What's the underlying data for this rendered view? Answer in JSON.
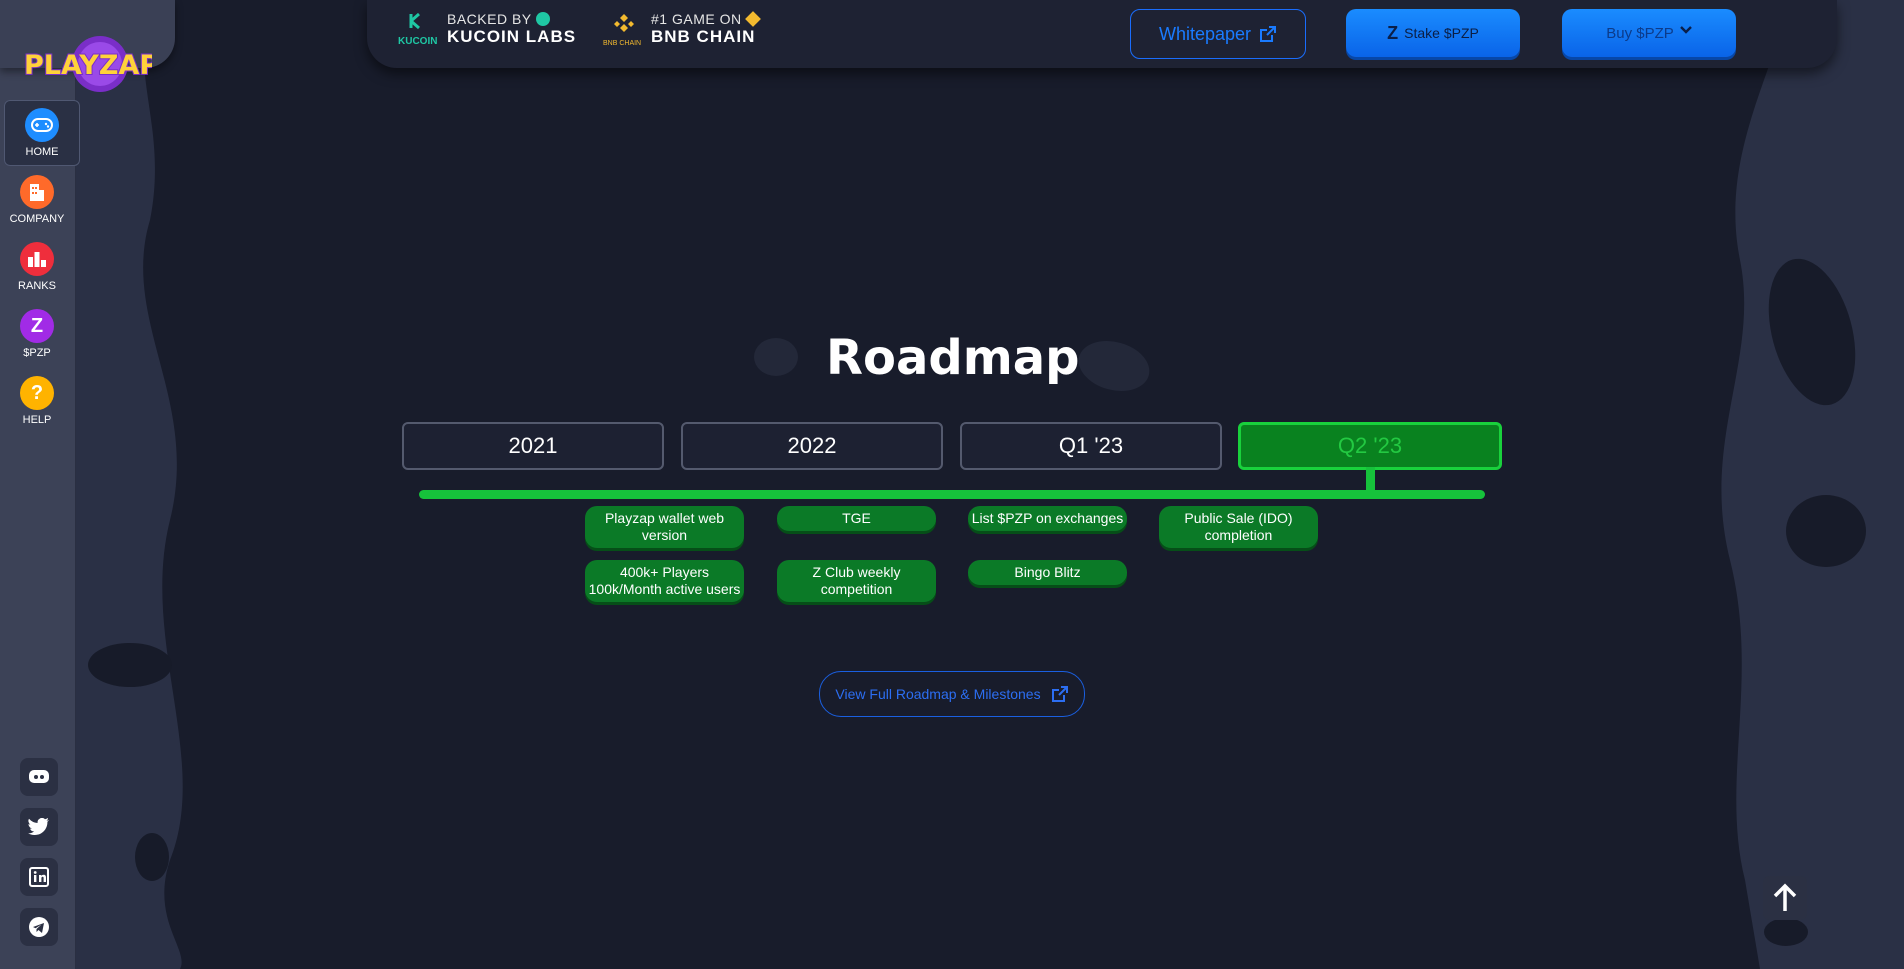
{
  "brand": {
    "logo_text": "PLAYZAP"
  },
  "sidebar": {
    "items": [
      {
        "label": "HOME",
        "icon": "gamepad-icon",
        "color": "#1e8dff"
      },
      {
        "label": "COMPANY",
        "icon": "building-icon",
        "color": "#ff6a2a"
      },
      {
        "label": "RANKS",
        "icon": "bar-chart-icon",
        "color": "#ef2e3c"
      },
      {
        "label": "$PZP",
        "icon": "pzp-coin-icon",
        "color": "#a12be6"
      },
      {
        "label": "HELP",
        "icon": "question-icon",
        "color": "#ffb300"
      }
    ],
    "socials": [
      "discord-icon",
      "twitter-icon",
      "linkedin-icon",
      "telegram-icon"
    ]
  },
  "header": {
    "backer1": {
      "small": "BACKED BY",
      "big": "KUCOIN LABS",
      "logo_text": "KUCOIN"
    },
    "backer2": {
      "small": "#1 GAME ON",
      "big": "BNB CHAIN",
      "logo_text": "BNB CHAIN"
    },
    "whitepaper_label": "Whitepaper",
    "stake_label": "Stake $PZP",
    "buy_label": "Buy $PZP"
  },
  "roadmap": {
    "title": "Roadmap",
    "tabs": [
      "2021",
      "2022",
      "Q1 '23",
      "Q2 '23"
    ],
    "active_tab": "Q2 '23",
    "milestones": {
      "col1": [
        "Playzap wallet web version",
        "400k+ Players 100k/Month active users"
      ],
      "col2": [
        "TGE",
        "Z Club weekly competition"
      ],
      "col3": [
        "List $PZP on exchanges",
        "Bingo Blitz"
      ],
      "col4": [
        "Public Sale (IDO) completion"
      ]
    },
    "view_full_label": "View Full Roadmap & Milestones"
  },
  "colors": {
    "accent_green": "#16c23b",
    "accent_blue": "#1a7bff",
    "background": "#181c2b"
  }
}
